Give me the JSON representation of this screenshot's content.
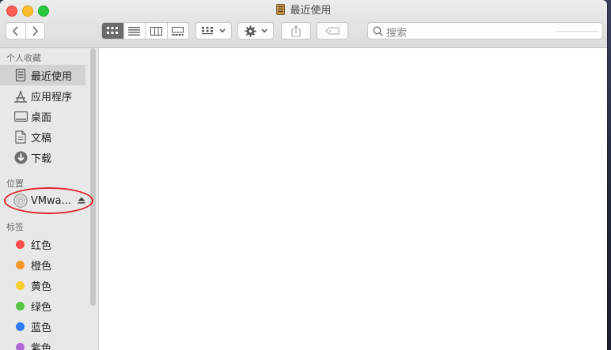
{
  "window": {
    "title": "最近使用"
  },
  "search": {
    "placeholder": "搜索"
  },
  "sidebar": {
    "favorites_header": "个人收藏",
    "favorites": [
      {
        "label": "最近使用",
        "icon": "recents-icon"
      },
      {
        "label": "应用程序",
        "icon": "applications-icon"
      },
      {
        "label": "桌面",
        "icon": "desktop-icon"
      },
      {
        "label": "文稿",
        "icon": "documents-icon"
      },
      {
        "label": "下载",
        "icon": "downloads-icon"
      }
    ],
    "locations_header": "位置",
    "locations": [
      {
        "label": "VMwa...",
        "icon": "disc-icon"
      }
    ],
    "tags_header": "标签",
    "tags": [
      {
        "label": "红色",
        "color": "#fc4b4b"
      },
      {
        "label": "橙色",
        "color": "#f5982b"
      },
      {
        "label": "黄色",
        "color": "#f7cf2a"
      },
      {
        "label": "绿色",
        "color": "#55c441"
      },
      {
        "label": "蓝色",
        "color": "#2f7cf6"
      },
      {
        "label": "紫色",
        "color": "#b06ad6"
      }
    ]
  },
  "annotation": {
    "color": "#e0262e"
  }
}
